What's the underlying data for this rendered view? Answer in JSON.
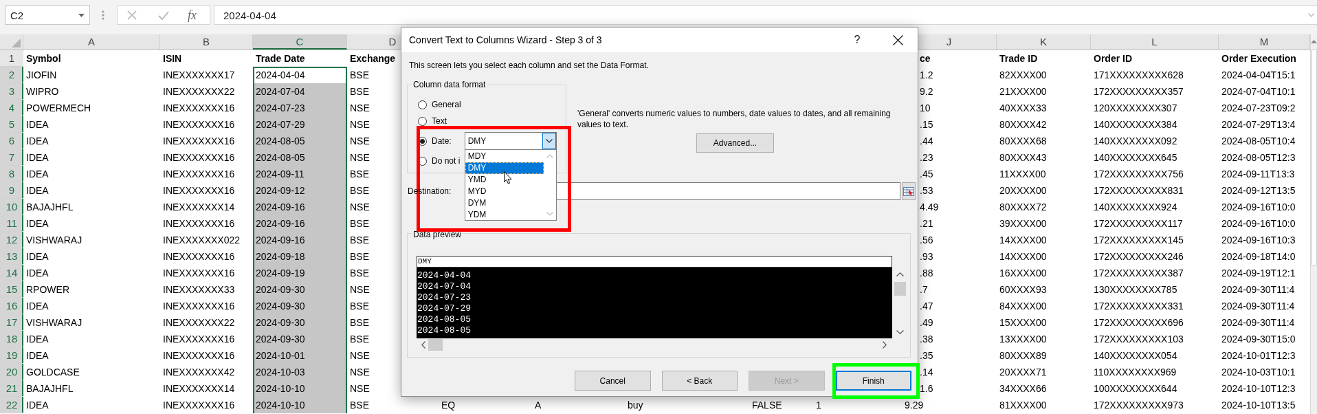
{
  "formula_bar": {
    "name_box": "C2",
    "function_label": "fx",
    "formula": "2024-04-04"
  },
  "sheet": {
    "columns": [
      {
        "letter": "A",
        "selected": false
      },
      {
        "letter": "B",
        "selected": false
      },
      {
        "letter": "C",
        "selected": true
      },
      {
        "letter": "D",
        "selected": false
      },
      {
        "letter": "J",
        "selected": false
      },
      {
        "letter": "K",
        "selected": false
      },
      {
        "letter": "L",
        "selected": false
      },
      {
        "letter": "M",
        "selected": false
      }
    ],
    "header_row": {
      "number": "1",
      "selected": false,
      "cells": [
        "Symbol",
        "ISIN",
        "Trade Date",
        "Exchange",
        "ce",
        "Trade ID",
        "Order ID",
        "Order Execution"
      ]
    },
    "rows": [
      {
        "number": "2",
        "selected": true,
        "cells": [
          "JIOFIN",
          "INEXXXXXXX17",
          "2024-04-04",
          "BSE",
          "1.2",
          "82XXXX00",
          "171XXXXXXXXX628",
          "2024-04-04T15:1"
        ]
      },
      {
        "number": "3",
        "selected": true,
        "cells": [
          "WIPRO",
          "INEXXXXXXX22",
          "2024-07-04",
          "BSE",
          "9.2",
          "21XXXX00",
          "172XXXXXXXXX357",
          "2024-07-04T10:1"
        ]
      },
      {
        "number": "4",
        "selected": true,
        "cells": [
          "POWERMECH",
          "INEXXXXXXX16",
          "2024-07-23",
          "NSE",
          "10",
          "40XXXX33",
          "120XXXXXXXX307",
          "2024-07-23T09:2"
        ]
      },
      {
        "number": "5",
        "selected": true,
        "cells": [
          "IDEA",
          "INEXXXXXXX16",
          "2024-07-29",
          "NSE",
          ".15",
          "80XXXX42",
          "140XXXXXXXX384",
          "2024-07-29T13:4"
        ]
      },
      {
        "number": "6",
        "selected": true,
        "cells": [
          "IDEA",
          "INEXXXXXXX16",
          "2024-08-05",
          "NSE",
          ".44",
          "80XXXX68",
          "140XXXXXXXX092",
          "2024-08-05T10:4"
        ]
      },
      {
        "number": "7",
        "selected": true,
        "cells": [
          "IDEA",
          "INEXXXXXXX16",
          "2024-08-05",
          "NSE",
          ".23",
          "80XXXX43",
          "140XXXXXXXX645",
          "2024-08-05T12:3"
        ]
      },
      {
        "number": "8",
        "selected": true,
        "cells": [
          "IDEA",
          "INEXXXXXXX16",
          "2024-09-11",
          "BSE",
          ".45",
          "11XXXX00",
          "172XXXXXXXXX756",
          "2024-09-11T13:3"
        ]
      },
      {
        "number": "9",
        "selected": true,
        "cells": [
          "IDEA",
          "INEXXXXXXX16",
          "2024-09-12",
          "BSE",
          ".53",
          "20XXXX00",
          "172XXXXXXXXX831",
          "2024-09-12T13:5"
        ]
      },
      {
        "number": "10",
        "selected": true,
        "cells": [
          "BAJAJHFL",
          "INEXXXXXXX14",
          "2024-09-16",
          "NSE",
          "4.49",
          "80XXXX72",
          "140XXXXXXXX924",
          "2024-09-16T10:0"
        ]
      },
      {
        "number": "11",
        "selected": true,
        "cells": [
          "IDEA",
          "INEXXXXXXX16",
          "2024-09-16",
          "BSE",
          ".21",
          "39XXXX00",
          "172XXXXXXXXX117",
          "2024-09-16T10:0"
        ]
      },
      {
        "number": "12",
        "selected": true,
        "cells": [
          "VISHWARAJ",
          "INEXXXXXXX022",
          "2024-09-16",
          "BSE",
          ".56",
          "14XXXX00",
          "172XXXXXXXXX145",
          "2024-09-16T10:3"
        ]
      },
      {
        "number": "13",
        "selected": true,
        "cells": [
          "IDEA",
          "INEXXXXXXX16",
          "2024-09-18",
          "BSE",
          ".93",
          "14XXXX00",
          "172XXXXXXXXX246",
          "2024-09-18T14:0"
        ]
      },
      {
        "number": "14",
        "selected": true,
        "cells": [
          "IDEA",
          "INEXXXXXXX16",
          "2024-09-19",
          "BSE",
          ".88",
          "16XXXX00",
          "172XXXXXXXXX387",
          "2024-09-19T12:1"
        ]
      },
      {
        "number": "15",
        "selected": true,
        "cells": [
          "RPOWER",
          "INEXXXXXXX33",
          "2024-09-30",
          "NSE",
          ".7",
          "60XXXX93",
          "130XXXXXXXX785",
          "2024-09-30T11:4"
        ]
      },
      {
        "number": "16",
        "selected": true,
        "cells": [
          "IDEA",
          "INEXXXXXXX16",
          "2024-09-30",
          "BSE",
          ".47",
          "84XXXX00",
          "172XXXXXXXXX331",
          "2024-09-30T11:4"
        ]
      },
      {
        "number": "17",
        "selected": true,
        "cells": [
          "VISHWARAJ",
          "INEXXXXXXX22",
          "2024-09-30",
          "BSE",
          ".49",
          "15XXXX00",
          "172XXXXXXXXX696",
          "2024-09-30T11:4"
        ]
      },
      {
        "number": "18",
        "selected": true,
        "cells": [
          "IDEA",
          "INEXXXXXXX16",
          "2024-09-30",
          "BSE",
          ".38",
          "13XXXX00",
          "172XXXXXXXXX103",
          "2024-09-30T15:0"
        ]
      },
      {
        "number": "19",
        "selected": true,
        "cells": [
          "IDEA",
          "INEXXXXXXX16",
          "2024-10-01",
          "NSE",
          ".35",
          "80XXXX89",
          "140XXXXXXXX054",
          "2024-10-01T12:3"
        ]
      },
      {
        "number": "20",
        "selected": true,
        "cells": [
          "GOLDCASE",
          "INEXXXXXXX42",
          "2024-10-03",
          "NSE",
          ".14",
          "20XXXX71",
          "110XXXXXXXX969",
          "2024-10-03T10:1"
        ]
      },
      {
        "number": "21",
        "selected": true,
        "cells": [
          "BAJAJHFL",
          "INEXXXXXXX14",
          "2024-10-10",
          "NSE",
          "1.6",
          "34XXXX66",
          "100XXXXXXXX644",
          "2024-10-10T12:3"
        ]
      },
      {
        "number": "22",
        "selected": true,
        "cells": [
          "IDEA",
          "INEXXXXXXX16",
          "2024-10-10",
          "BSE",
          "9.29",
          "81XXXX00",
          "172XXXXXXXXX973",
          "2024-10-10T13:5"
        ],
        "middle_cells": [
          "EQ",
          "A",
          "buy",
          "FALSE",
          "1"
        ]
      }
    ]
  },
  "dialog": {
    "title": "Convert Text to Columns Wizard - Step 3 of 3",
    "help": "?",
    "intro": "This screen lets you select each column and set the Data Format.",
    "format_group": {
      "legend": "Column data format",
      "options": [
        {
          "kind": "plain",
          "label": "General",
          "selected": false
        },
        {
          "kind": "plain",
          "label": "Text",
          "selected": false
        },
        {
          "kind": "date",
          "label": "Date:",
          "selected": true
        },
        {
          "kind": "plain",
          "label": "Do not i",
          "selected": false
        }
      ]
    },
    "date_format": {
      "value": "DMY",
      "expanded": true,
      "options": [
        {
          "label": "MDY",
          "selected": false
        },
        {
          "label": "DMY",
          "selected": true
        },
        {
          "label": "YMD",
          "selected": false
        },
        {
          "label": "MYD",
          "selected": false
        },
        {
          "label": "DYM",
          "selected": false
        },
        {
          "label": "YDM",
          "selected": false
        }
      ]
    },
    "explanation": "'General' converts numeric values to numbers, date values to dates, and all remaining values to text.",
    "advanced_button": "Advanced...",
    "destination": {
      "label": "Destination:"
    },
    "preview": {
      "legend": "Data preview",
      "column_header": "DMY",
      "lines": [
        "2024-04-04",
        "2024-07-04",
        "2024-07-23",
        "2024-07-29",
        "2024-08-05",
        "2024-08-05"
      ]
    },
    "buttons": [
      {
        "label": "Cancel",
        "disabled": false,
        "default": false
      },
      {
        "label": "< Back",
        "disabled": false,
        "default": false
      },
      {
        "label": "Next >",
        "disabled": true,
        "default": false
      },
      {
        "label": "Finish",
        "disabled": false,
        "default": true
      }
    ]
  },
  "annotations": [
    {
      "kind": "rectangle",
      "color": "#ff0000"
    },
    {
      "kind": "rectangle",
      "color": "#00ff00"
    }
  ]
}
